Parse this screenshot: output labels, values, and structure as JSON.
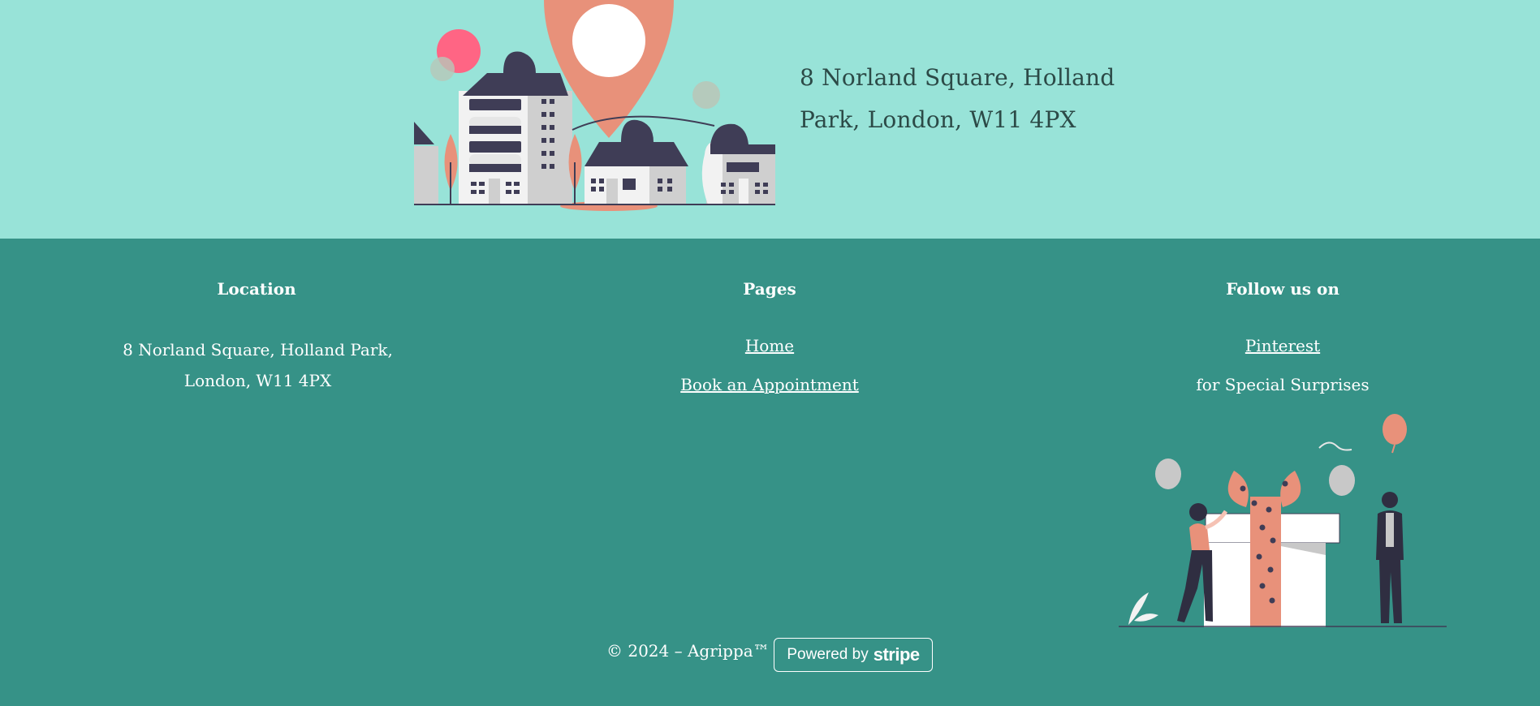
{
  "banner": {
    "address_line1": "8 Norland Square, Holland",
    "address_line2": "Park, London, W11 4PX"
  },
  "footer": {
    "location": {
      "heading": "Location",
      "address_line1": "8 Norland Square, Holland Park,",
      "address_line2": "London, W11 4PX"
    },
    "pages": {
      "heading": "Pages",
      "links": [
        "Home",
        "Book an Appointment"
      ]
    },
    "follow": {
      "heading": "Follow us on",
      "link": "Pinterest",
      "note": "for Special Surprises"
    },
    "copyright": "© 2024 – Agrippa™",
    "stripe": {
      "prefix": "Powered by",
      "brand": "stripe"
    }
  },
  "colors": {
    "banner_bg": "#98e3d8",
    "footer_bg": "#369287",
    "accent": "#e8917a",
    "dark": "#3f3d56"
  },
  "icons": [
    "city-map-pin-illustration",
    "gift-box-people-illustration"
  ]
}
